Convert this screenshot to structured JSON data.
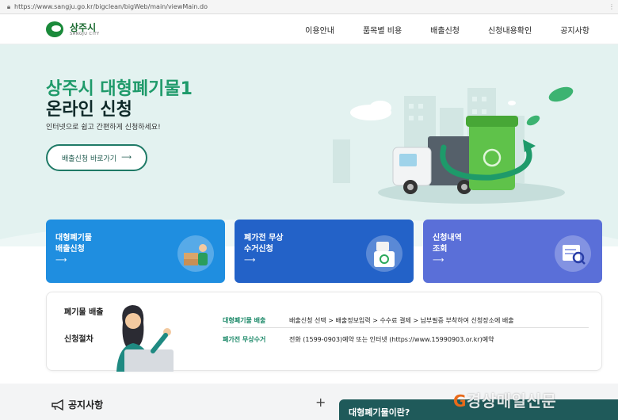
{
  "browser": {
    "url": "https://www.sangju.go.kr/bigclean/bigWeb/main/viewMain.do"
  },
  "header": {
    "logo_ko": "상주시",
    "logo_en": "SANGJU CITY",
    "nav": [
      "이용안내",
      "품목별 비용",
      "배출신청",
      "신청내용확인",
      "공지사항"
    ]
  },
  "hero": {
    "title1": "상주시 대형폐기물1",
    "title2": "온라인 신청",
    "subtitle": "인터넷으로 쉽고 간편하게 신청하세요!",
    "button_label": "배출신청 바로가기",
    "button_arrow": "⟶"
  },
  "cards": [
    {
      "line1": "대형폐기물",
      "line2": "배출신청",
      "arrow": "⟶",
      "color": "#1f8ee0",
      "icon": "person-boxes-icon"
    },
    {
      "line1": "폐가전 무상",
      "line2": "수거신청",
      "arrow": "⟶",
      "color": "#2362c8",
      "icon": "recycle-bin-icon"
    },
    {
      "line1": "신청내역",
      "line2": "조회",
      "arrow": "⟶",
      "color": "#5a6fd8",
      "icon": "document-search-icon"
    }
  ],
  "procedure": {
    "title1": "폐기물 배출",
    "title2": "신청절차",
    "rows": [
      {
        "label": "대형폐기물 배출",
        "value": "배출신청 선택 > 배출정보입력 > 수수료 결제 > 납부필증 부착하여 신청장소에 배출"
      },
      {
        "label": "폐가전 무상수거",
        "value": "전화 (1599-0903)예약 또는 인터넷 (https://www.15990903.or.kr)예약"
      }
    ]
  },
  "notice": {
    "title": "공지사항",
    "plus": "+"
  },
  "faq": {
    "title": "대형폐기물이란?"
  },
  "watermark": {
    "text": "경상매일신문"
  }
}
